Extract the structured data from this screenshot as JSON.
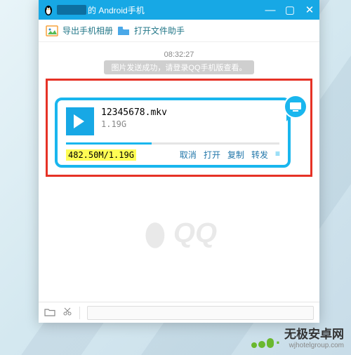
{
  "titlebar": {
    "suffix": "的 Android手机"
  },
  "wincontrols": {
    "min": "—",
    "max": "▢",
    "close": "✕"
  },
  "toolbar": {
    "export_label": "导出手机相册",
    "openhelper_label": "打开文件助手"
  },
  "chat": {
    "timestamp": "08:32:27",
    "system_msg": "图片发送成功，请登录QQ手机版查看。"
  },
  "file": {
    "name": "12345678.mkv",
    "size": "1.19G",
    "progress_text": "482.50M/1.19G",
    "progress_pct": 40,
    "actions": {
      "cancel": "取消",
      "open": "打开",
      "copy": "复制",
      "forward": "转发"
    }
  },
  "qq_watermark": "QQ",
  "brand": {
    "cn": "无极安卓网",
    "en": "wjhotelgroup.com"
  }
}
